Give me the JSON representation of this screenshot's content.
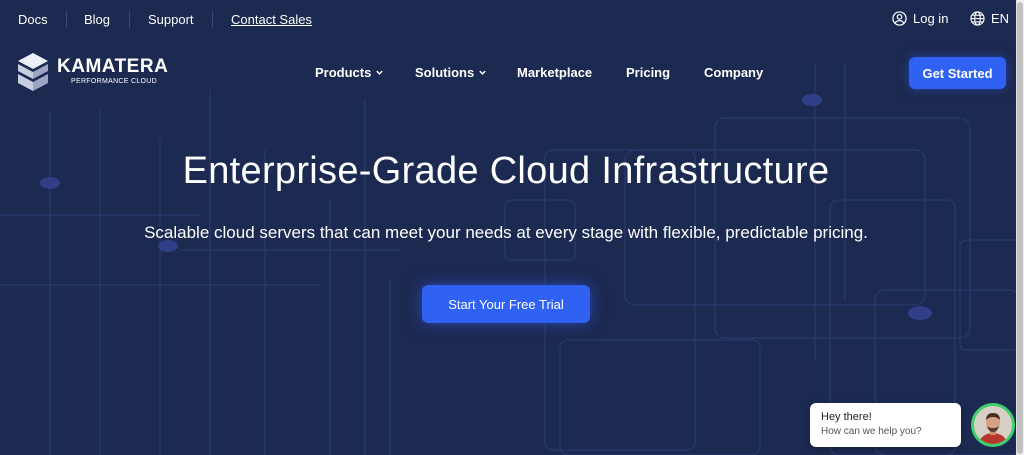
{
  "topbar": {
    "links": [
      "Docs",
      "Blog",
      "Support",
      "Contact Sales"
    ],
    "login_label": "Log in",
    "language": "EN"
  },
  "brand": {
    "name": "KAMATERA",
    "tagline": "PERFORMANCE CLOUD"
  },
  "nav": {
    "items": [
      {
        "label": "Products",
        "has_dropdown": true
      },
      {
        "label": "Solutions",
        "has_dropdown": true
      },
      {
        "label": "Marketplace",
        "has_dropdown": false
      },
      {
        "label": "Pricing",
        "has_dropdown": false
      },
      {
        "label": "Company",
        "has_dropdown": false
      }
    ],
    "cta_label": "Get Started"
  },
  "hero": {
    "title": "Enterprise-Grade Cloud Infrastructure",
    "subtitle": "Scalable cloud servers that can meet your needs at every stage with flexible, predictable pricing.",
    "button_label": "Start Your Free Trial"
  },
  "chat": {
    "title": "Hey there!",
    "text": "How can we help you?"
  },
  "colors": {
    "background": "#1c2950",
    "accent": "#2f62f2",
    "avatar_ring": "#3ecf6e"
  }
}
